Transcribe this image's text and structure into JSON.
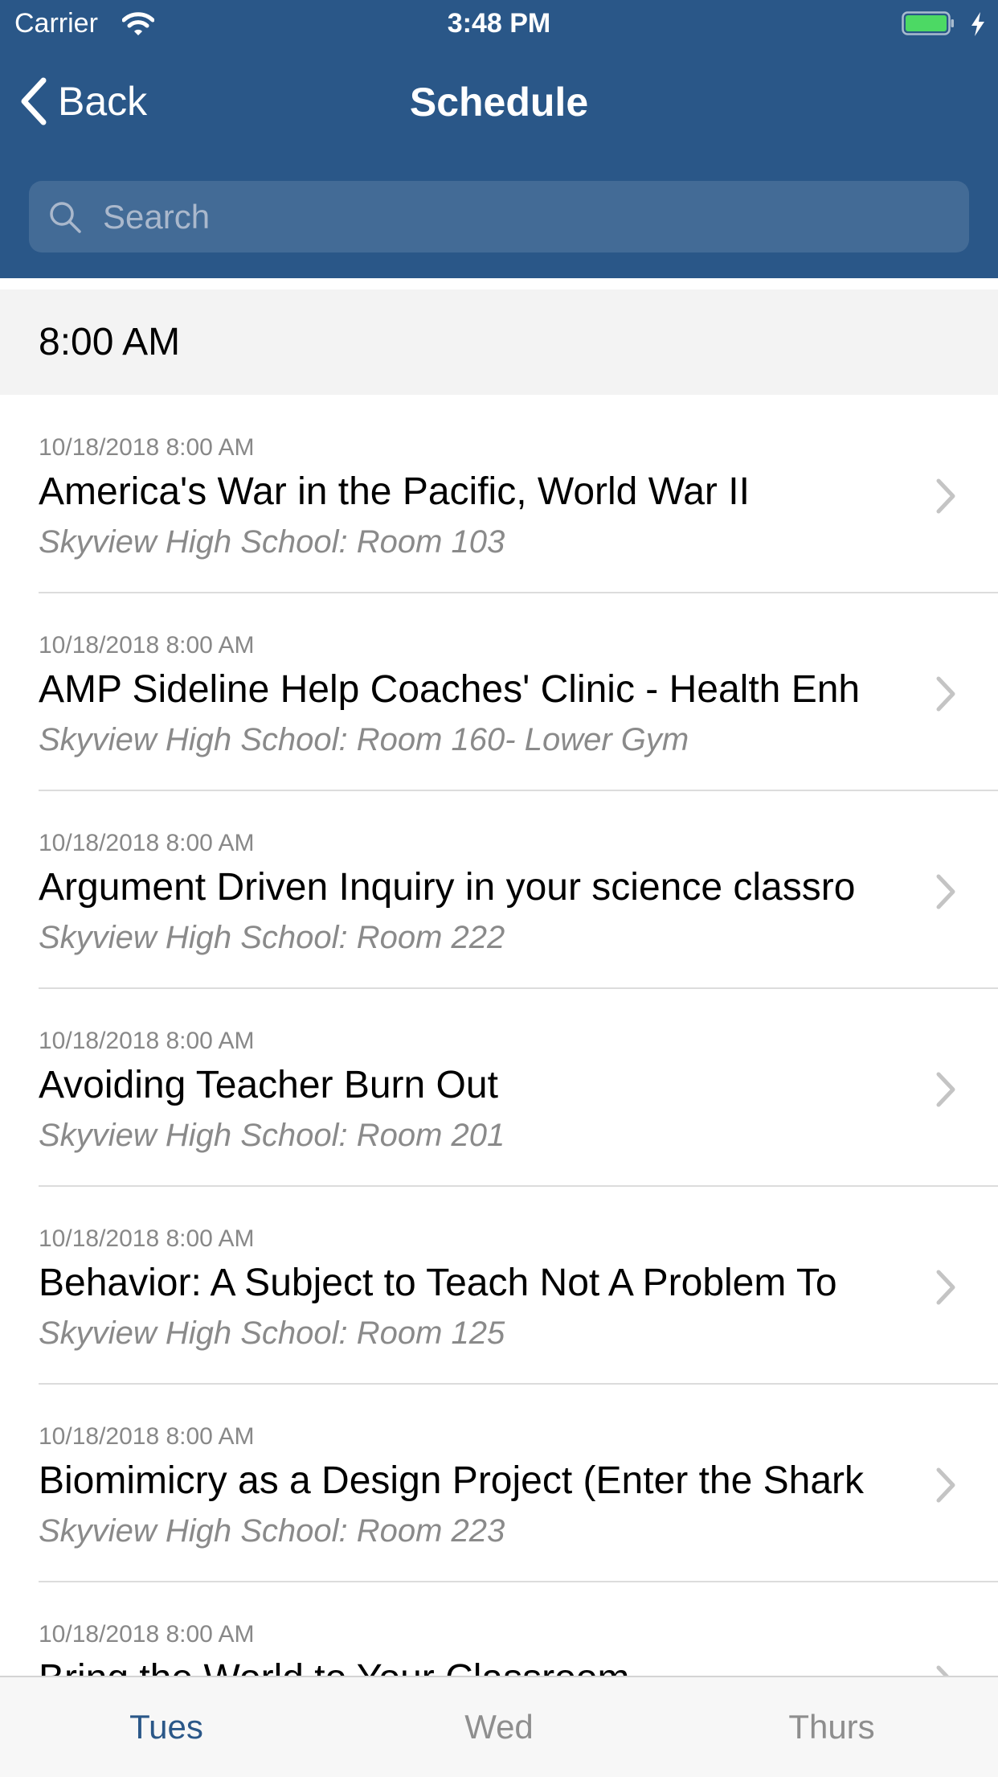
{
  "status_bar": {
    "carrier": "Carrier",
    "time": "3:48 PM",
    "wifi_icon": "wifi-icon",
    "battery_icon": "battery-icon",
    "battery_color": "#4cd964"
  },
  "nav": {
    "back_label": "Back",
    "title": "Schedule"
  },
  "search": {
    "placeholder": "Search",
    "value": ""
  },
  "section": {
    "header": "8:00 AM"
  },
  "sessions": [
    {
      "date": "10/18/2018 8:00 AM",
      "title": "America's War in the Pacific, World War II",
      "location": "Skyview High School: Room 103"
    },
    {
      "date": "10/18/2018 8:00 AM",
      "title": "AMP Sideline Help Coaches' Clinic - Health Enh",
      "location": "Skyview High School: Room 160- Lower Gym"
    },
    {
      "date": "10/18/2018 8:00 AM",
      "title": "Argument Driven Inquiry in your science classro",
      "location": "Skyview High School: Room 222"
    },
    {
      "date": "10/18/2018 8:00 AM",
      "title": "Avoiding Teacher Burn Out",
      "location": "Skyview High School: Room 201"
    },
    {
      "date": "10/18/2018 8:00 AM",
      "title": "Behavior: A Subject to Teach Not A Problem To",
      "location": "Skyview High School: Room 125"
    },
    {
      "date": "10/18/2018 8:00 AM",
      "title": "Biomimicry as a Design Project (Enter the Shark",
      "location": "Skyview High School: Room 223"
    },
    {
      "date": "10/18/2018 8:00 AM",
      "title": "Bring the World to Your Classroom",
      "location": ""
    }
  ],
  "tabs": [
    {
      "label": "Tues",
      "active": true
    },
    {
      "label": "Wed",
      "active": false
    },
    {
      "label": "Thurs",
      "active": false
    }
  ],
  "colors": {
    "brand": "#2a5788",
    "section_bg": "#f3f3f3",
    "muted": "#8a8a8a"
  }
}
